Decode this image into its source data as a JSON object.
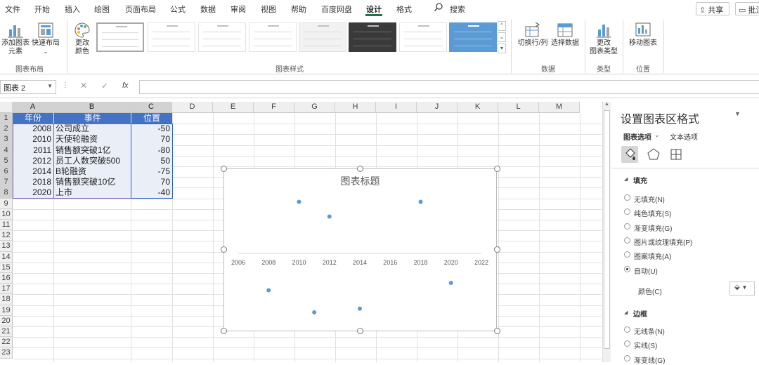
{
  "menu": {
    "tabs": [
      "文件",
      "开始",
      "插入",
      "绘图",
      "页面布局",
      "公式",
      "数据",
      "审阅",
      "视图",
      "帮助",
      "百度网盘",
      "设计",
      "格式"
    ],
    "active_tab": "设计",
    "search": "搜索",
    "share": "共享",
    "comments": "批注"
  },
  "ribbon": {
    "add_element_1": "添加图表",
    "add_element_2": "元素",
    "quick_layout": "快速布局",
    "change_colors_1": "更改",
    "change_colors_2": "颜色",
    "group_layout": "图表布局",
    "group_styles": "图表样式",
    "switch_row_col": "切换行/列",
    "select_data": "选择数据",
    "group_data": "数据",
    "change_type_1": "更改",
    "change_type_2": "图表类型",
    "group_type": "类型",
    "move_chart": "移动图表",
    "group_location": "位置"
  },
  "formula_bar": {
    "name_box": "图表 2",
    "fx": "fx",
    "formula": ""
  },
  "sheet": {
    "columns": [
      "A",
      "B",
      "C",
      "D",
      "E",
      "F",
      "G",
      "H",
      "I",
      "J",
      "K",
      "L",
      "M"
    ],
    "rows": [
      "1",
      "2",
      "3",
      "4",
      "5",
      "6",
      "7",
      "8",
      "9",
      "10",
      "11",
      "12",
      "13",
      "14",
      "15",
      "16",
      "17",
      "18",
      "19",
      "20",
      "21",
      "22",
      "23"
    ],
    "headers": [
      "年份",
      "事件",
      "位置"
    ],
    "data": [
      [
        "2008",
        "公司成立",
        "-50"
      ],
      [
        "2010",
        "天使轮融资",
        "70"
      ],
      [
        "2011",
        "销售额突破1亿",
        "-80"
      ],
      [
        "2012",
        "员工人数突破500",
        "50"
      ],
      [
        "2014",
        "B轮融资",
        "-75"
      ],
      [
        "2018",
        "销售额突破10亿",
        "70"
      ],
      [
        "2020",
        "上市",
        "-40"
      ]
    ]
  },
  "chart_data": {
    "type": "scatter",
    "title": "图表标题",
    "x": [
      2008,
      2010,
      2011,
      2012,
      2014,
      2018,
      2020
    ],
    "y": [
      -50,
      70,
      -80,
      50,
      -75,
      70,
      -40
    ],
    "xlim": [
      2006,
      2022
    ],
    "ylim": [
      -100,
      100
    ],
    "x_ticks": [
      "2006",
      "2008",
      "2010",
      "2012",
      "2014",
      "2016",
      "2018",
      "2020",
      "2022"
    ],
    "point_color": "#5b9bd5",
    "grid": false,
    "legend": "none"
  },
  "pane": {
    "title": "设置图表区格式",
    "tab_chart": "图表选项",
    "tab_text": "文本选项",
    "fill_section": "填充",
    "fill_options": [
      "无填充(N)",
      "纯色填充(S)",
      "渐变填充(G)",
      "图片或纹理填充(P)",
      "图案填充(A)",
      "自动(U)"
    ],
    "fill_selected": 5,
    "color_label": "颜色(C)",
    "border_section": "边框",
    "border_options": [
      "无线条(N)",
      "实线(S)",
      "渐变线(G)"
    ]
  },
  "colors": {
    "accent": "#217346",
    "table_header": "#4472c4",
    "selection": "#eaeef7"
  }
}
